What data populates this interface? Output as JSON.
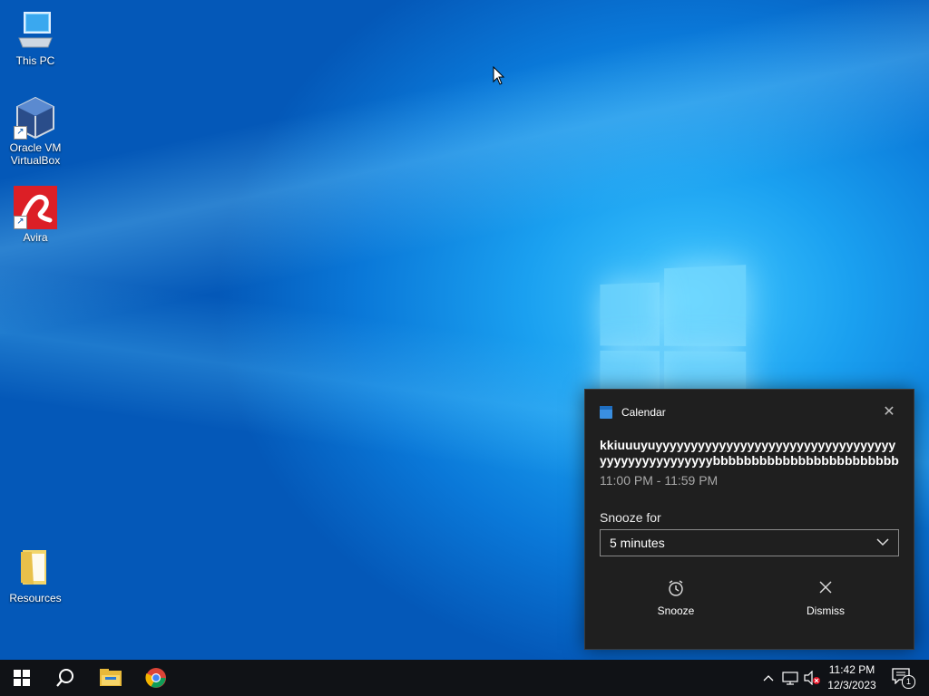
{
  "desktop": {
    "icons": [
      {
        "label": "This PC",
        "icon": "this-pc-icon"
      },
      {
        "label": "Oracle VM VirtualBox",
        "icon": "virtualbox-icon"
      },
      {
        "label": "Avira",
        "icon": "avira-icon"
      },
      {
        "label": "Resources",
        "icon": "folder-icon"
      }
    ]
  },
  "notification": {
    "app_name": "Calendar",
    "title_line1": "kkiuuuyuyyyyyyyyyyyyyyyyyyyyyyyyyyyyyyyyyy",
    "title_line2": "yyyyyyyyyyyyyyyybbbbbbbbbbbbbbbbbbbbbbbbbbbbl",
    "time_range": "11:00 PM - 11:59 PM",
    "snooze_label": "Snooze for",
    "snooze_selected": "5 minutes",
    "snooze_button": "Snooze",
    "dismiss_button": "Dismiss"
  },
  "taskbar": {
    "clock_time": "11:42 PM",
    "clock_date": "12/3/2023",
    "notification_count": "1",
    "pinned": [
      "start-icon",
      "search-icon",
      "file-explorer-icon",
      "chrome-icon"
    ]
  }
}
